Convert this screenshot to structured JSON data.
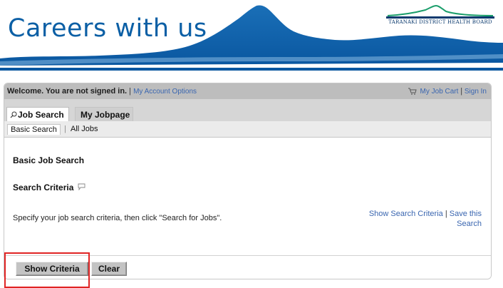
{
  "banner": {
    "title": "Careers with us",
    "logo_text": "TARANAKI DISTRICT HEALTH BOARD"
  },
  "topbar": {
    "welcome": "Welcome. You are not signed in.",
    "separator": "|",
    "account_link": "My Account Options",
    "cart_link": "My Job Cart",
    "signin_link": "Sign In"
  },
  "tabs": [
    {
      "label": "Job Search",
      "active": true
    },
    {
      "label": "My Jobpage",
      "active": false
    }
  ],
  "subtabs": [
    {
      "label": "Basic Search",
      "active": true
    },
    {
      "label": "All Jobs",
      "active": false
    }
  ],
  "content": {
    "heading": "Basic Job Search",
    "criteria_heading": "Search Criteria",
    "instructions": "Specify your job search criteria, then click \"Search for Jobs\".",
    "show_criteria_link": "Show Search Criteria",
    "save_search_link": "Save this Search"
  },
  "buttons": {
    "show_criteria": "Show Criteria",
    "clear": "Clear"
  },
  "colors": {
    "brand_blue": "#0b5fa5",
    "link_blue": "#3a66b0",
    "highlight_red": "#e02424"
  },
  "icons": [
    "magnifier-icon",
    "cart-icon",
    "speech-bubble-icon",
    "mountain-graphic",
    "logo-mountain-icon"
  ]
}
